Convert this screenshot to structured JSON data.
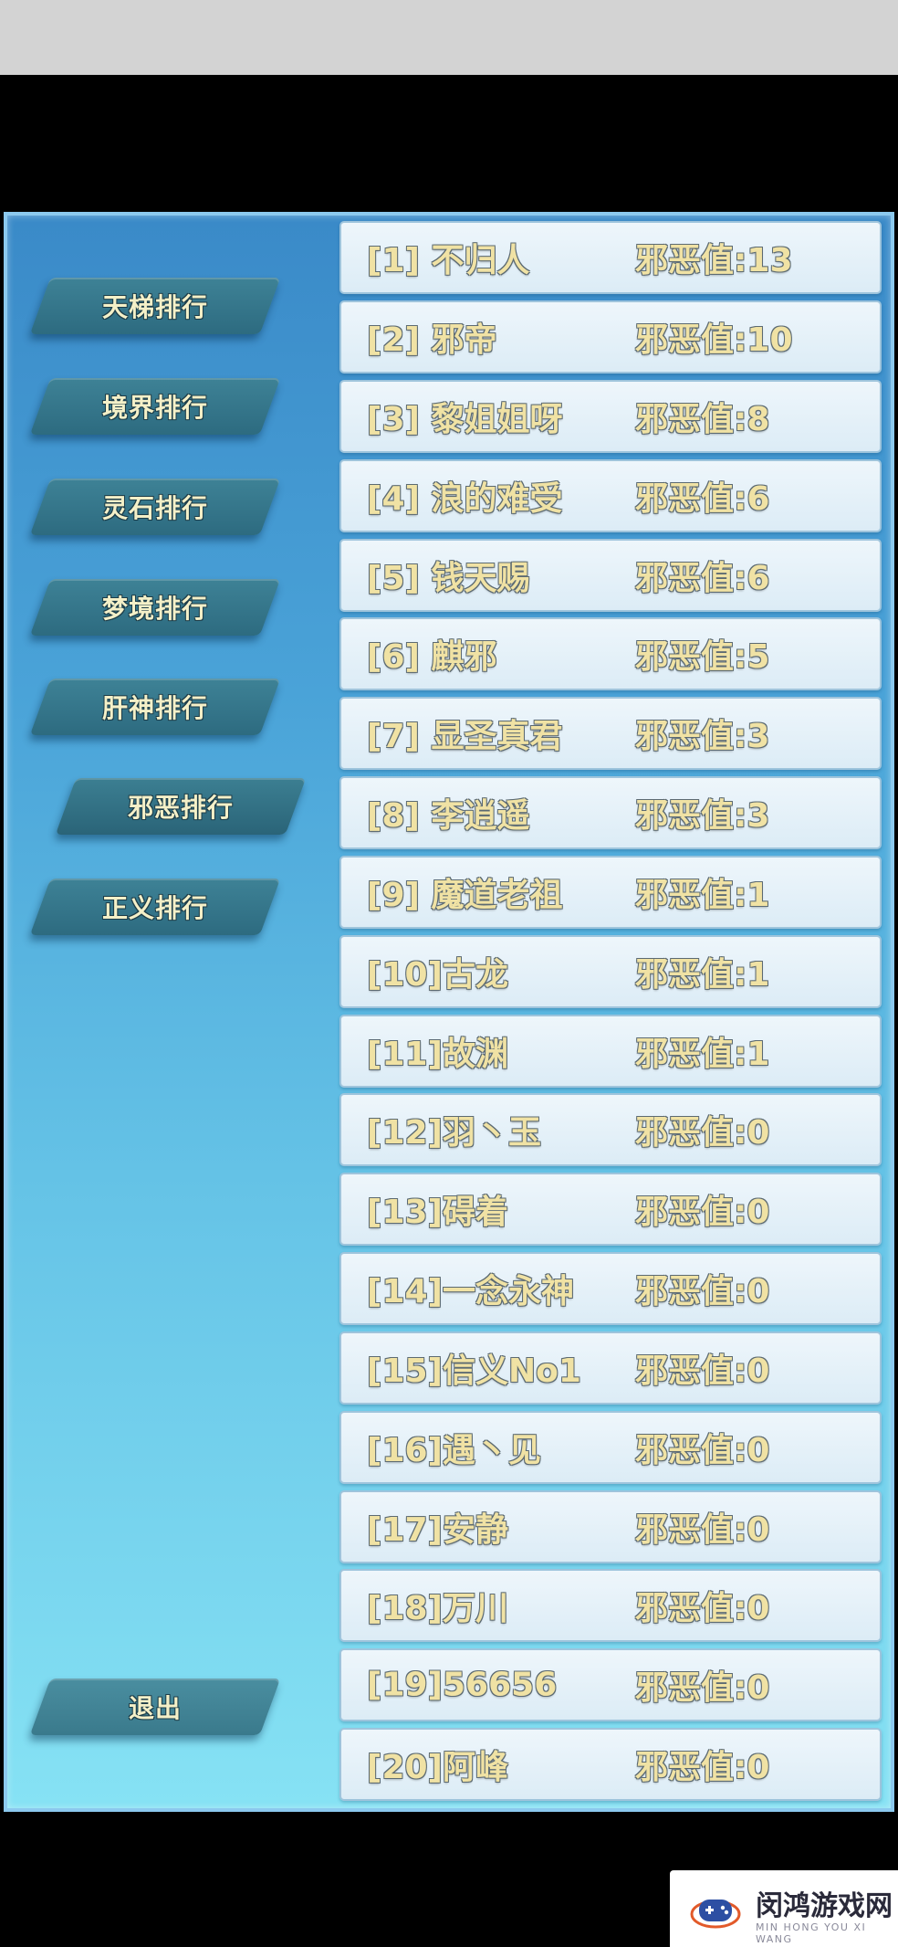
{
  "nav": [
    {
      "label": "天梯排行",
      "active": false
    },
    {
      "label": "境界排行",
      "active": false
    },
    {
      "label": "灵石排行",
      "active": false
    },
    {
      "label": "梦境排行",
      "active": false
    },
    {
      "label": "肝神排行",
      "active": false
    },
    {
      "label": "邪恶排行",
      "active": true
    },
    {
      "label": "正义排行",
      "active": false
    }
  ],
  "exit_label": "退出",
  "ranking": [
    {
      "rank": "[1] 不归人",
      "value": "邪恶值:13"
    },
    {
      "rank": "[2] 邪帝",
      "value": "邪恶值:10"
    },
    {
      "rank": "[3] 黎姐姐呀",
      "value": "邪恶值:8"
    },
    {
      "rank": "[4] 浪的难受",
      "value": "邪恶值:6"
    },
    {
      "rank": "[5] 钱天赐",
      "value": "邪恶值:6"
    },
    {
      "rank": "[6] 麒邪",
      "value": "邪恶值:5"
    },
    {
      "rank": "[7] 显圣真君",
      "value": "邪恶值:3"
    },
    {
      "rank": "[8] 李逍遥",
      "value": "邪恶值:3"
    },
    {
      "rank": "[9] 魔道老祖",
      "value": "邪恶值:1"
    },
    {
      "rank": "[10]古龙",
      "value": "邪恶值:1"
    },
    {
      "rank": "[11]故渊",
      "value": "邪恶值:1"
    },
    {
      "rank": "[12]羽丶玉",
      "value": "邪恶值:0"
    },
    {
      "rank": "[13]碍着",
      "value": "邪恶值:0"
    },
    {
      "rank": "[14]一念永神",
      "value": "邪恶值:0"
    },
    {
      "rank": "[15]信义No1",
      "value": "邪恶值:0"
    },
    {
      "rank": "[16]遇丶见",
      "value": "邪恶值:0"
    },
    {
      "rank": "[17]安静",
      "value": "邪恶值:0"
    },
    {
      "rank": "[18]万川",
      "value": "邪恶值:0"
    },
    {
      "rank": "[19]56656",
      "value": "邪恶值:0"
    },
    {
      "rank": "[20]阿峰",
      "value": "邪恶值:0"
    }
  ],
  "watermark": {
    "title": "闵鸿游戏网",
    "subtitle": "MIN HONG YOU XI WANG",
    "icon": "gamepad-logo-icon"
  }
}
